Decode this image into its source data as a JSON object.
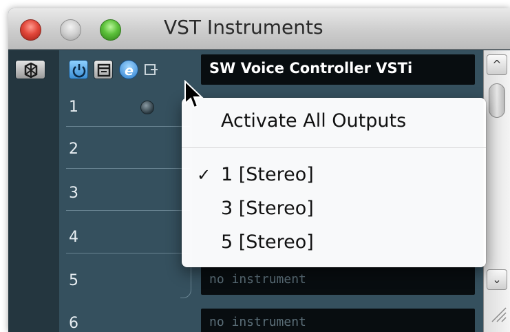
{
  "window": {
    "title": "VST Instruments"
  },
  "toolbar": {
    "icons": [
      "freeze-icon",
      "power-icon",
      "rack-icon",
      "edit-icon",
      "outputs-icon"
    ]
  },
  "slots": [
    {
      "number": "1",
      "instrument": "SW Voice Controller VSTi"
    },
    {
      "number": "2",
      "instrument": ""
    },
    {
      "number": "3",
      "instrument": ""
    },
    {
      "number": "4",
      "instrument": ""
    },
    {
      "number": "5",
      "instrument": "no instrument"
    },
    {
      "number": "6",
      "instrument": "no instrument"
    }
  ],
  "menu": {
    "activate_all": "Activate All Outputs",
    "outputs": [
      {
        "label": "1 [Stereo]",
        "checked": true
      },
      {
        "label": "3 [Stereo]",
        "checked": false
      },
      {
        "label": "5 [Stereo]",
        "checked": false
      }
    ],
    "check_glyph": "✓"
  },
  "scrollbar": {
    "up_glyph": "^",
    "down_glyph": "⌄"
  },
  "colors": {
    "panel": "#35505e",
    "field": "#080d10",
    "power_accent": "#3b8fd6"
  }
}
